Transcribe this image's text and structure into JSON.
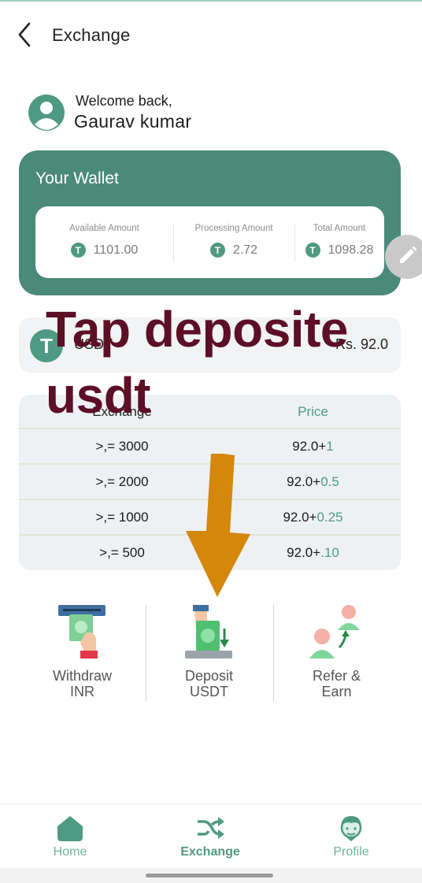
{
  "header": {
    "title": "Exchange"
  },
  "welcome": {
    "greeting": "Welcome back,",
    "user_name": "Gaurav kumar"
  },
  "wallet": {
    "title": "Your Wallet",
    "available_label": "Available Amount",
    "available_value": "1101.00",
    "processing_label": "Processing Amount",
    "processing_value": "2.72",
    "total_label": "Total Amount",
    "total_value": "1098.28",
    "coin_symbol": "T"
  },
  "usdt": {
    "name": "USDT",
    "price": "Rs. 92.0",
    "logo_symbol": "T"
  },
  "rate_table": {
    "headers": {
      "exchange": "Exchange",
      "price": "Price"
    },
    "rows": [
      {
        "exchange": ">,= 3000",
        "base": "92.0+",
        "bonus": "1"
      },
      {
        "exchange": ">,= 2000",
        "base": "92.0+",
        "bonus": "0.5"
      },
      {
        "exchange": ">,= 1000",
        "base": "92.0+",
        "bonus": "0.25"
      },
      {
        "exchange": ">,= 500",
        "base": "92.0+",
        "bonus": ".10"
      }
    ]
  },
  "overlay": {
    "line1": "Tap deposite",
    "line2": "usdt",
    "color": "#5c0f26",
    "arrow_color": "#d4870a"
  },
  "actions": [
    {
      "line1": "Withdraw",
      "line2": "INR",
      "icon": "atm-withdraw-icon"
    },
    {
      "line1": "Deposit",
      "line2": "USDT",
      "icon": "cash-deposit-icon"
    },
    {
      "line1": "Refer &",
      "line2": "Earn",
      "icon": "refer-people-icon"
    }
  ],
  "bottom_nav": {
    "home": "Home",
    "exchange": "Exchange",
    "profile": "Profile",
    "active": "exchange"
  },
  "colors": {
    "brand": "#4b8a79",
    "accent": "#4f9a82"
  }
}
